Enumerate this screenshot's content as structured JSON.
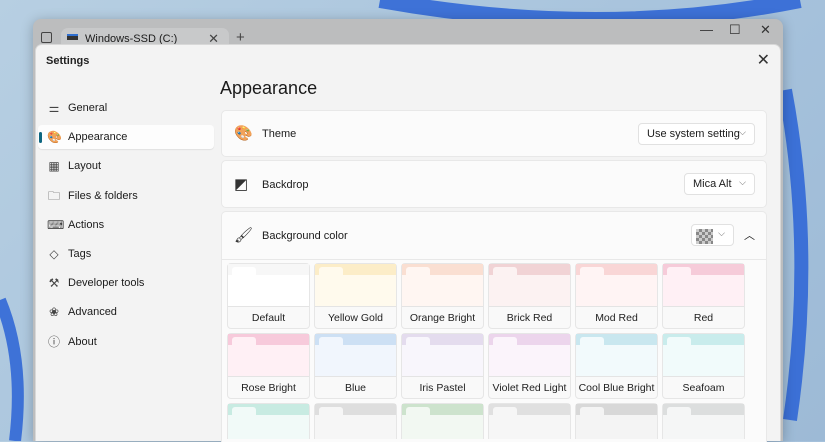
{
  "tab": {
    "title": "Windows-SSD (C:)"
  },
  "dialog": {
    "title": "Settings"
  },
  "nav": [
    {
      "label": "General",
      "icon": "sliders-icon",
      "glyph": "⚌"
    },
    {
      "label": "Appearance",
      "icon": "palette-icon",
      "glyph": "🎨",
      "selected": true
    },
    {
      "label": "Layout",
      "icon": "layout-icon",
      "glyph": "▦"
    },
    {
      "label": "Files & folders",
      "icon": "folder-icon",
      "glyph": "🗀"
    },
    {
      "label": "Actions",
      "icon": "actions-icon",
      "glyph": "⌨"
    },
    {
      "label": "Tags",
      "icon": "tag-icon",
      "glyph": "◇"
    },
    {
      "label": "Developer tools",
      "icon": "developer-tools-icon",
      "glyph": "⚒"
    },
    {
      "label": "Advanced",
      "icon": "advanced-icon",
      "glyph": "❀"
    },
    {
      "label": "About",
      "icon": "info-icon",
      "glyph": "ⓘ"
    }
  ],
  "main": {
    "title": "Appearance",
    "theme": {
      "label": "Theme",
      "value": "Use system setting"
    },
    "backdrop": {
      "label": "Backdrop",
      "value": "Mica Alt"
    },
    "background": {
      "label": "Background color"
    }
  },
  "colors": [
    {
      "name": "Default",
      "top": "#f7f7f7",
      "body": "#ffffff"
    },
    {
      "name": "Yellow Gold",
      "top": "#fcedc8",
      "body": "#fffaed"
    },
    {
      "name": "Orange Bright",
      "top": "#fadfd2",
      "body": "#fff6f2"
    },
    {
      "name": "Brick Red",
      "top": "#f1d3d5",
      "body": "#fcf2f2"
    },
    {
      "name": "Mod Red",
      "top": "#f9d6d6",
      "body": "#fff4f4"
    },
    {
      "name": "Red",
      "top": "#f6cbd9",
      "body": "#fff0f5"
    },
    {
      "name": "Rose Bright",
      "top": "#f7cadb",
      "body": "#fff0f5"
    },
    {
      "name": "Blue",
      "top": "#cde0f4",
      "body": "#f1f6fd"
    },
    {
      "name": "Iris Pastel",
      "top": "#e4dcee",
      "body": "#f8f6fc"
    },
    {
      "name": "Violet Red Light",
      "top": "#ecd5ec",
      "body": "#fbf4fb"
    },
    {
      "name": "Cool Blue Bright",
      "top": "#c9e7ef",
      "body": "#f2fafc"
    },
    {
      "name": "Seafoam",
      "top": "#c9ecec",
      "body": "#f1fbfb"
    },
    {
      "name": "",
      "top": "#c8ebe2",
      "body": "#f1faf8"
    },
    {
      "name": "",
      "top": "#dedede",
      "body": "#f6f6f6"
    },
    {
      "name": "",
      "top": "#cde3cd",
      "body": "#f2f8f2"
    },
    {
      "name": "",
      "top": "#e0e0e0",
      "body": "#f6f6f6"
    },
    {
      "name": "",
      "top": "#d8d8d8",
      "body": "#f4f4f4"
    },
    {
      "name": "",
      "top": "#dcdede",
      "body": "#f5f6f6"
    }
  ]
}
